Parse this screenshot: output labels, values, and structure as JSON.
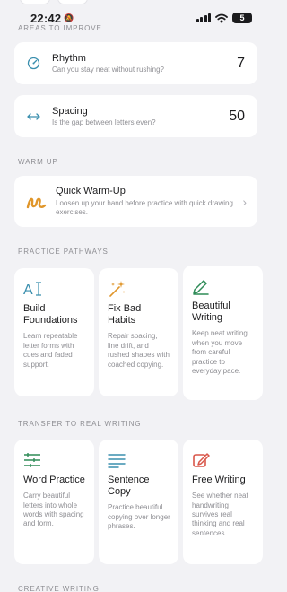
{
  "status_bar": {
    "time": "22:42",
    "battery": "5"
  },
  "areas": {
    "label": "AREAS TO IMPROVE",
    "items": [
      {
        "title": "Rhythm",
        "subtitle": "Can you stay neat without rushing?",
        "value": "7",
        "icon": "rhythm-gauge-icon"
      },
      {
        "title": "Spacing",
        "subtitle": "Is the gap between letters even?",
        "value": "50",
        "icon": "spacing-arrows-icon"
      }
    ]
  },
  "warm_up": {
    "label": "WARM UP",
    "title": "Quick Warm-Up",
    "subtitle": "Loosen up your hand before practice with quick drawing exercises.",
    "icon": "squiggle-icon"
  },
  "practice_pathways": {
    "label": "PRACTICE PATHWAYS",
    "tiles": [
      {
        "title": "Build Foundations",
        "desc": "Learn repeatable letter forms with cues and faded support.",
        "icon": "text-cursor-icon"
      },
      {
        "title": "Fix Bad Habits",
        "desc": "Repair spacing, line drift, and rushed shapes with coached copying.",
        "icon": "magic-wand-icon"
      },
      {
        "title": "Beautiful Writing",
        "desc": "Keep neat writing when you move from careful practice to everyday pace.",
        "icon": "pen-icon"
      }
    ]
  },
  "transfer": {
    "label": "TRANSFER TO REAL WRITING",
    "tiles": [
      {
        "title": "Word Practice",
        "desc": "Carry beautiful letters into whole words with spacing and form.",
        "icon": "word-lines-icon"
      },
      {
        "title": "Sentence Copy",
        "desc": "Practice beautiful copying over longer phrases.",
        "icon": "text-lines-icon"
      },
      {
        "title": "Free Writing",
        "desc": "See whether neat handwriting survives real thinking and real sentences.",
        "icon": "edit-square-icon"
      }
    ]
  },
  "creative": {
    "label": "CREATIVE WRITING"
  },
  "colors": {
    "blue": "#3a8fae",
    "green": "#2e8b57",
    "orange": "#e0962a",
    "red": "#d9574a",
    "background": "#f2f2f5"
  }
}
